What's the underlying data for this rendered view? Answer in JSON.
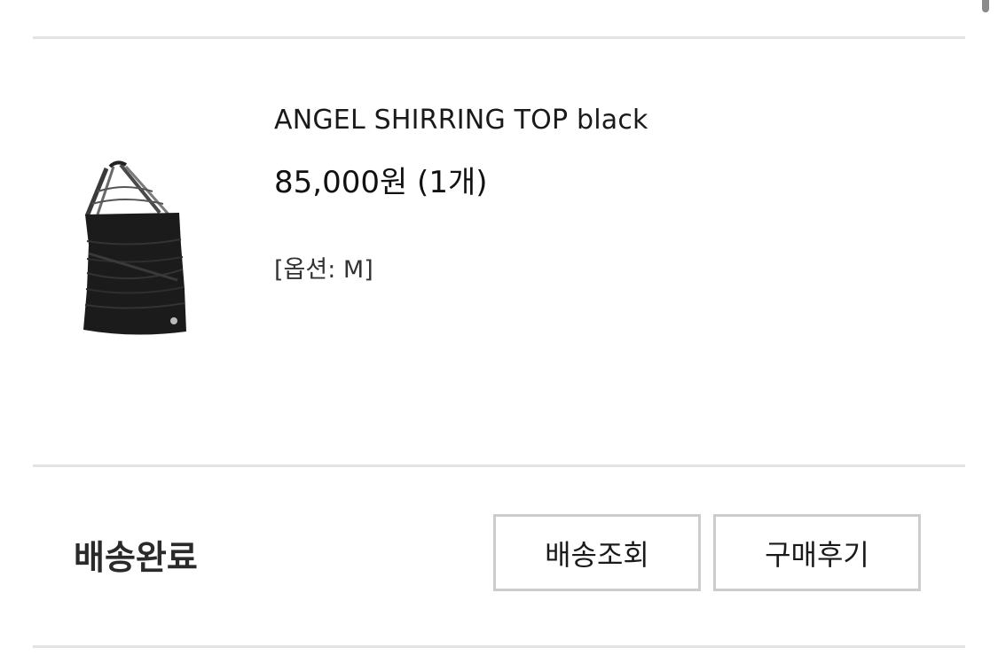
{
  "order_item": {
    "product_name": "ANGEL SHIRRING TOP black",
    "price": "85,000원 (1개)",
    "option": "[옵션: M]",
    "image_icon": "product-photo-black-halter-top"
  },
  "status": {
    "label": "배송완료"
  },
  "actions": {
    "track_label": "배송조회",
    "review_label": "구매후기"
  },
  "colors": {
    "divider": "#e3e3e3",
    "button_border": "#cccccc",
    "text": "#1a1a1a"
  }
}
